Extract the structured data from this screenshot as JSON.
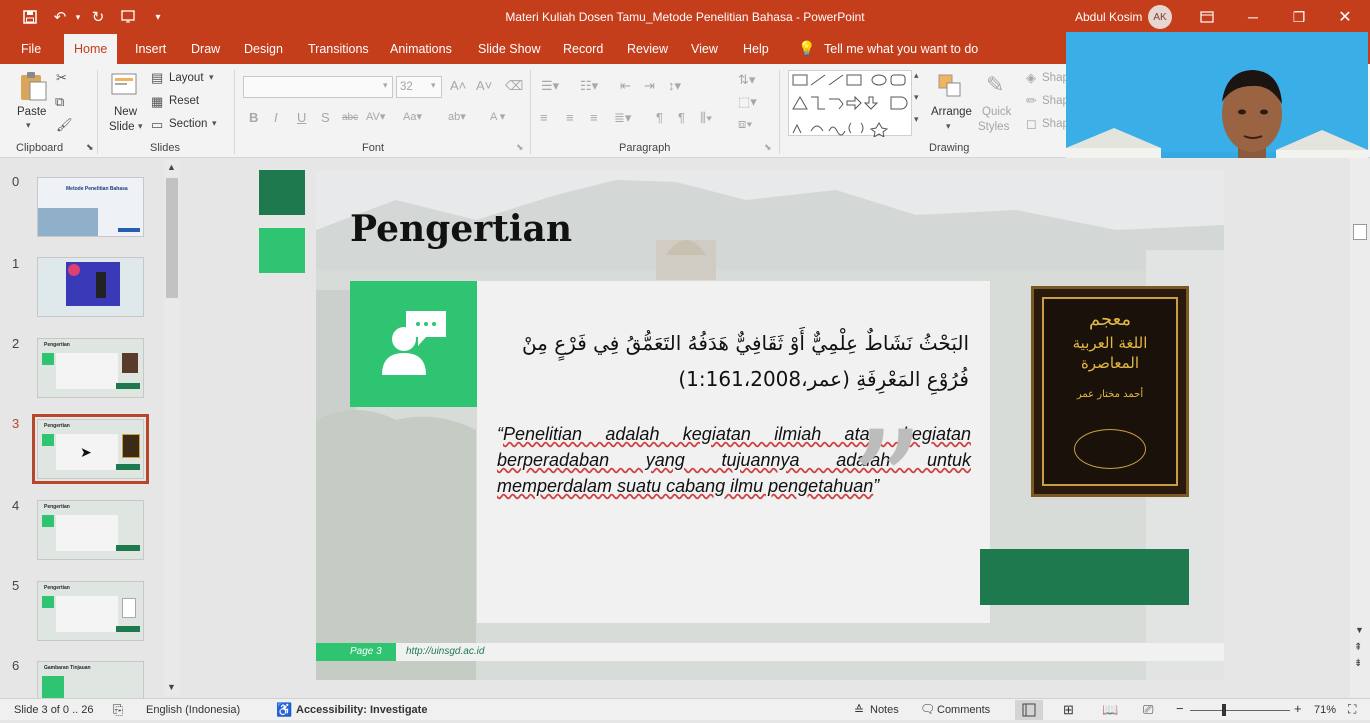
{
  "window": {
    "title": "Materi Kuliah Dosen Tamu_Metode Penelitian Bahasa  -  PowerPoint",
    "user_name": "Abdul Kosim",
    "user_initials": "AK"
  },
  "tabs": [
    "File",
    "Home",
    "Insert",
    "Draw",
    "Design",
    "Transitions",
    "Animations",
    "Slide Show",
    "Record",
    "Review",
    "View",
    "Help"
  ],
  "tell_me": "Tell me what you want to do",
  "ribbon": {
    "clipboard": {
      "paste": "Paste",
      "group": "Clipboard"
    },
    "slides": {
      "new_slide_1": "New",
      "new_slide_2": "Slide",
      "layout": "Layout",
      "reset": "Reset",
      "section": "Section",
      "group": "Slides"
    },
    "font": {
      "size": "32",
      "group": "Font"
    },
    "paragraph": {
      "group": "Paragraph"
    },
    "drawing": {
      "arrange": "Arrange",
      "quick_styles_1": "Quick",
      "quick_styles_2": "Styles",
      "shape_1": "Shap",
      "shape_2": "Shap",
      "shape_3": "Shap",
      "group": "Drawing"
    }
  },
  "thumbnails": [
    {
      "num": "0",
      "title": "Metode Penelitian Bahasa"
    },
    {
      "num": "1",
      "title": ""
    },
    {
      "num": "2",
      "title": "Pengertian"
    },
    {
      "num": "3",
      "title": "Pengertian"
    },
    {
      "num": "4",
      "title": "Pengertian"
    },
    {
      "num": "5",
      "title": "Pengertian"
    },
    {
      "num": "6",
      "title": "Gambaran Tinjauan"
    }
  ],
  "slide": {
    "title": "Pengertian",
    "arabic_line1": "البَحْثُ نَشَاطٌ عِلْمِيٌّ أَوْ ثَقَافِيٌّ هَدَفُهُ التَعَمُّقُ فِي فَرْعٍ مِنْ",
    "arabic_line2": "فُرُوْعِ المَعْرِفَةِ (عمر،1:161،2008)",
    "quote_open": "“",
    "quote_lines": [
      "Penelitian adalah kegiatan ilmiah atau kegiatan",
      "berperadaban yang tujuannya adalah untuk",
      "memperdalam suatu cabang ilmu pengetahuan"
    ],
    "quote_close": "”",
    "book_title_1": "معجم",
    "book_title_2": "اللغة العربية المعاصرة",
    "book_author": "أحمد مختار عمر",
    "page_label": "Page  3",
    "url": "http://uinsgd.ac.id"
  },
  "status": {
    "slide_info": "Slide 3 of 0 .. 26",
    "language": "English (Indonesia)",
    "accessibility": "Accessibility: Investigate",
    "notes": "Notes",
    "comments": "Comments",
    "zoom": "71%"
  },
  "colors": {
    "brand": "#c43e1c",
    "slide_green_dark": "#1e7a4e",
    "slide_green_light": "#2ec472",
    "selection": "#b7472a"
  }
}
